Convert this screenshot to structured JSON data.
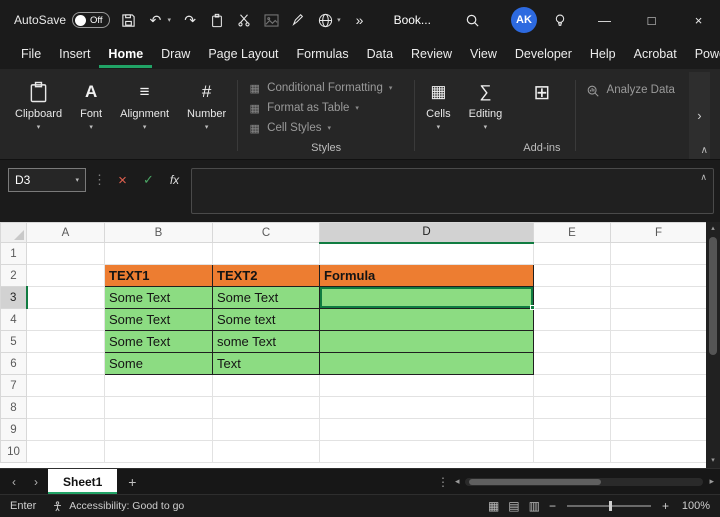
{
  "titlebar": {
    "autosave_label": "AutoSave",
    "autosave_state": "Off",
    "workbook_title": "Book...",
    "avatar_initials": "AK"
  },
  "menubar": {
    "items": [
      "File",
      "Insert",
      "Home",
      "Draw",
      "Page Layout",
      "Formulas",
      "Data",
      "Review",
      "View",
      "Developer",
      "Help",
      "Acrobat",
      "Power Pivot"
    ],
    "active_item": "Home"
  },
  "ribbon": {
    "groups": [
      {
        "label": "Clipboard"
      },
      {
        "label": "Font"
      },
      {
        "label": "Alignment"
      },
      {
        "label": "Number"
      }
    ],
    "styles": {
      "label": "Styles",
      "buttons": [
        "Conditional Formatting",
        "Format as Table",
        "Cell Styles"
      ]
    },
    "cells_label": "Cells",
    "editing_label": "Editing",
    "addins_label": "Add-ins",
    "analyze_label": "Analyze Data"
  },
  "formula_bar": {
    "name_box": "D3",
    "formula": ""
  },
  "sheet": {
    "columns": [
      "A",
      "B",
      "C",
      "D",
      "E",
      "F"
    ],
    "rows": [
      "1",
      "2",
      "3",
      "4",
      "5",
      "6",
      "7",
      "8",
      "9",
      "10"
    ],
    "active_cell": "D3",
    "selected_column": "D",
    "selected_row": "3",
    "cells": {
      "B2": "TEXT1",
      "C2": "TEXT2",
      "D2": "Formula",
      "B3": "Some Text",
      "C3": "Some Text",
      "D3": "",
      "B4": "Some Text",
      "C4": "Some text",
      "D4": "",
      "B5": "Some Text",
      "C5": "some Text",
      "D5": "",
      "B6": "Some",
      "C6": "Text",
      "D6": ""
    },
    "orange_cells": [
      "B2",
      "C2",
      "D2"
    ],
    "green_cells": [
      "B3",
      "C3",
      "D3",
      "B4",
      "C4",
      "D4",
      "B5",
      "C5",
      "D5",
      "B6",
      "C6",
      "D6"
    ],
    "colors": {
      "orange": "#ED7D31",
      "green": "#8CDC82",
      "selection": "#107C41"
    }
  },
  "tabbar": {
    "tabs": [
      "Sheet1"
    ],
    "active_tab": "Sheet1"
  },
  "statusbar": {
    "mode": "Enter",
    "accessibility": "Accessibility: Good to go",
    "zoom": "100%"
  },
  "icons": {
    "chevron_down": "▾",
    "chevron_up": "∧",
    "undo": "↶",
    "redo": "↷",
    "overflow": "»",
    "dots_vertical": "⋮",
    "cancel": "×",
    "confirm": "✓",
    "fx": "fx",
    "minimize": "—",
    "maximize": "□",
    "close": "×",
    "nav_left": "‹",
    "nav_right": "›",
    "add": "+",
    "font": "A",
    "alignment": "≡",
    "number": "#",
    "cells": "▦",
    "editing": "∑",
    "addins": "⊞",
    "style_swatch": "▦",
    "view_normal": "▦",
    "view_layout": "▤",
    "view_break": "▥",
    "zoom_out": "−",
    "zoom_in": "+",
    "scroll_left": "◂",
    "scroll_right": "▸",
    "scroll_up": "▴",
    "scroll_down": "▾",
    "more_right": "›"
  }
}
